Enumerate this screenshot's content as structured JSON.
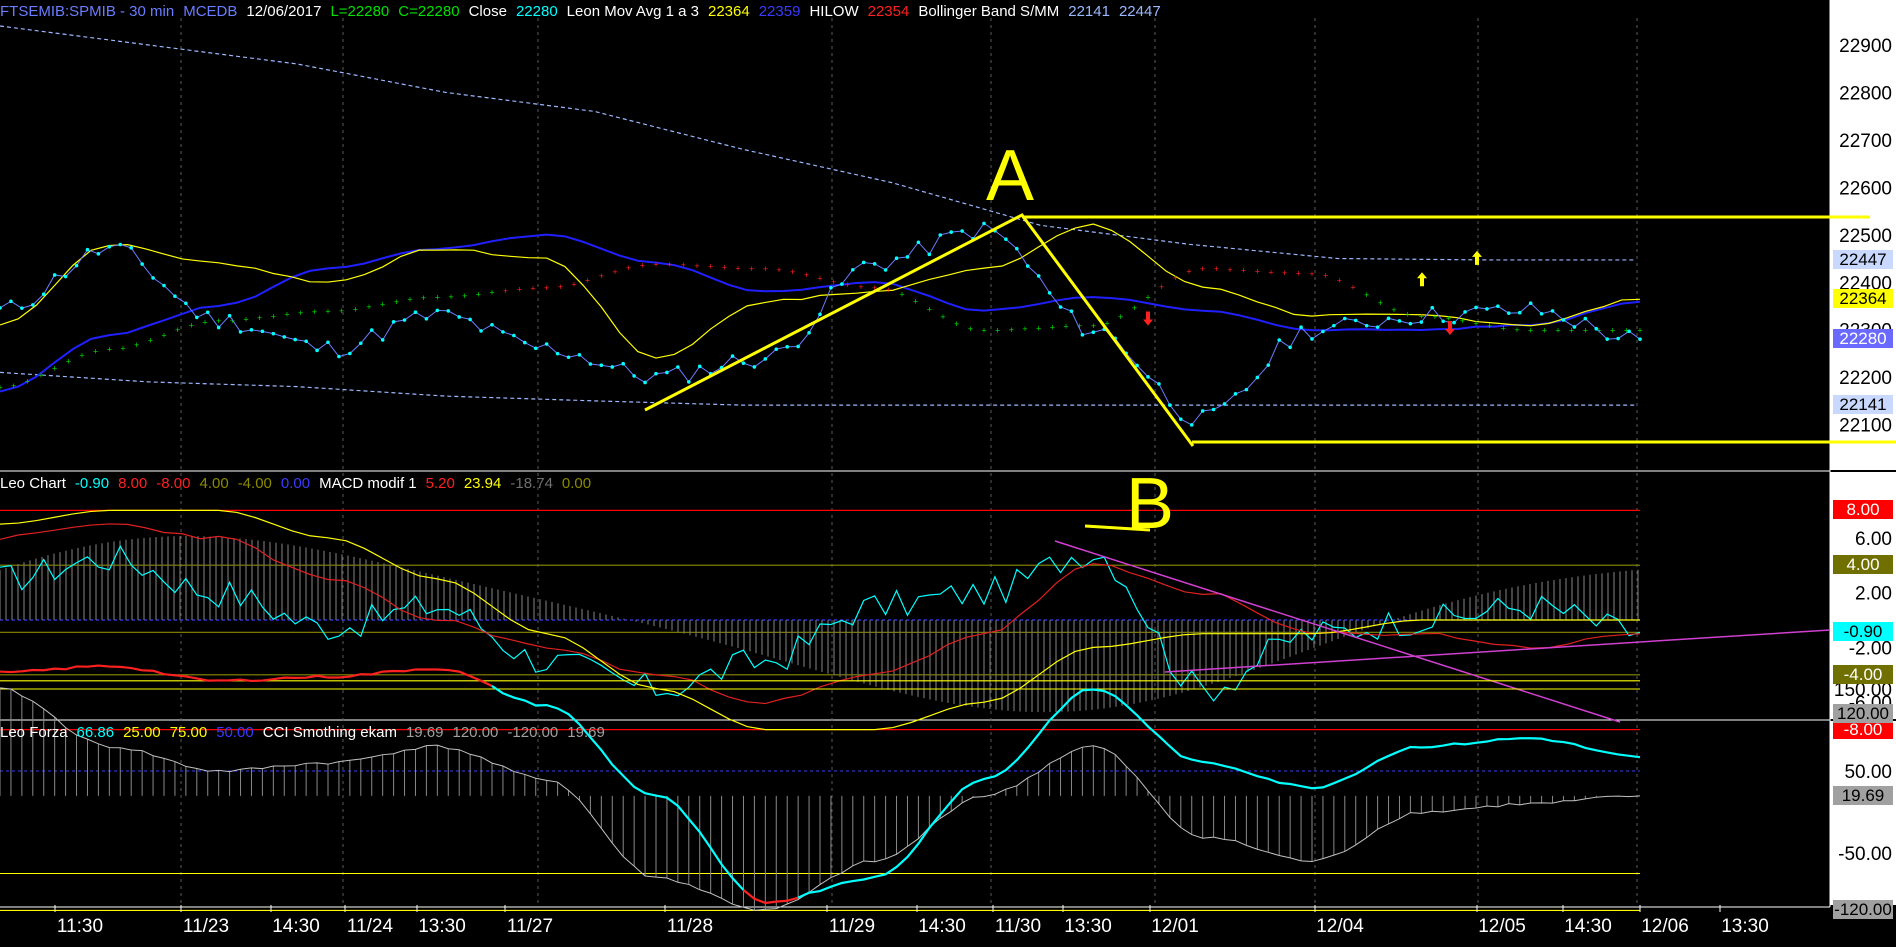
{
  "header_main": [
    {
      "text": "FTSEMIB:SPMIB - 30 min",
      "color": "#6a7dff"
    },
    {
      "text": "MCEDB",
      "color": "#6a7dff"
    },
    {
      "text": "12/06/2017",
      "color": "#ffffff"
    },
    {
      "text": "L=22280",
      "color": "#00e000"
    },
    {
      "text": "C=22280",
      "color": "#00e000"
    },
    {
      "text": "Close",
      "color": "#ffffff"
    },
    {
      "text": "22280",
      "color": "#00ffff"
    },
    {
      "text": "Leon Mov Avg 1 a 3",
      "color": "#ffffff"
    },
    {
      "text": "22364",
      "color": "#ffff00"
    },
    {
      "text": "22359",
      "color": "#3a3aff"
    },
    {
      "text": "HILOW",
      "color": "#ffffff"
    },
    {
      "text": "22354",
      "color": "#ff2020"
    },
    {
      "text": "Bollinger Band S/MM",
      "color": "#ffffff"
    },
    {
      "text": "22141",
      "color": "#9ab8ff"
    },
    {
      "text": "22447",
      "color": "#9ab8ff"
    }
  ],
  "header_mid": [
    {
      "text": "Leo Chart",
      "color": "#ffffff"
    },
    {
      "text": "-0.90",
      "color": "#00ffff"
    },
    {
      "text": "8.00",
      "color": "#ff2020"
    },
    {
      "text": "-8.00",
      "color": "#ff2020"
    },
    {
      "text": "4.00",
      "color": "#8a8a00"
    },
    {
      "text": "-4.00",
      "color": "#8a8a00"
    },
    {
      "text": "0.00",
      "color": "#3a3aff"
    },
    {
      "text": "MACD modif 1",
      "color": "#ffffff"
    },
    {
      "text": "5.20",
      "color": "#ff2020"
    },
    {
      "text": "23.94",
      "color": "#ffff00"
    },
    {
      "text": "-18.74",
      "color": "#707070"
    },
    {
      "text": "0.00",
      "color": "#8a8a00"
    }
  ],
  "header_low": [
    {
      "text": "Leo Forza",
      "color": "#ffffff"
    },
    {
      "text": "66.86",
      "color": "#00ffff"
    },
    {
      "text": "25.00",
      "color": "#ffff00"
    },
    {
      "text": "75.00",
      "color": "#ffff00"
    },
    {
      "text": "50.00",
      "color": "#3a3aff"
    },
    {
      "text": "CCI Smothing ekam",
      "color": "#ffffff"
    },
    {
      "text": "19.69",
      "color": "#a0a0a0"
    },
    {
      "text": "120.00",
      "color": "#a0a0a0"
    },
    {
      "text": "-120.00",
      "color": "#a0a0a0"
    },
    {
      "text": "19.69",
      "color": "#a0a0a0"
    }
  ],
  "axis_main": [
    "22900",
    "22800",
    "22700",
    "22600",
    "22500",
    "22400",
    "22300",
    "22200",
    "22100"
  ],
  "axis_mid": [
    "6.00",
    "2.00",
    "-2.00",
    "-6.00"
  ],
  "axis_low": [
    "150.00",
    "50.00",
    "-50.00"
  ],
  "tags_main": [
    {
      "text": "22447",
      "bg": "#c8d8ff",
      "fg": "#000000"
    },
    {
      "text": "22364",
      "bg": "#ffff00",
      "fg": "#000000"
    },
    {
      "text": "22280",
      "bg": "#6a6aff",
      "fg": "#ffffff"
    },
    {
      "text": "22141",
      "bg": "#c8d8ff",
      "fg": "#000000"
    }
  ],
  "tags_mid": [
    {
      "text": "8.00",
      "bg": "#ff0000",
      "fg": "#ffffff"
    },
    {
      "text": "4.00",
      "bg": "#707000",
      "fg": "#ffffff"
    },
    {
      "text": "-0.90",
      "bg": "#00ffff",
      "fg": "#000000"
    },
    {
      "text": "-4.00",
      "bg": "#707000",
      "fg": "#ffffff"
    },
    {
      "text": "-8.00",
      "bg": "#ff0000",
      "fg": "#ffffff"
    }
  ],
  "tags_low": [
    {
      "text": "120.00",
      "bg": "#a0a0a0",
      "fg": "#000000"
    },
    {
      "text": "19.69",
      "bg": "#a0a0a0",
      "fg": "#000000"
    },
    {
      "text": "-120.00",
      "bg": "#a0a0a0",
      "fg": "#000000"
    }
  ],
  "time_labels": [
    "11:30",
    "11/23",
    "14:30",
    "11/24",
    "13:30",
    "11/27",
    "11/28",
    "11/29",
    "14:30",
    "11/30",
    "13:30",
    "12/01",
    "12/04",
    "12/05",
    "14:30",
    "12/06",
    "13:30"
  ],
  "annotations": [
    "A",
    "B"
  ],
  "colors": {
    "background": "#000000",
    "close": "#00ffff",
    "hilow": "#2020ff",
    "leon_avg": "#ffff00",
    "bollinger": "#9ab8ff",
    "drawing": "#ffff00",
    "trend_magenta": "#d040d0"
  },
  "chart_data": [
    {
      "type": "line",
      "title": "FTSEMIB:SPMIB - 30 min",
      "ylim": [
        22080,
        22960
      ],
      "x": [
        "11/22 11:30",
        "11/23",
        "11/23 14:30",
        "11/24",
        "11/24 13:30",
        "11/27",
        "11/28",
        "11/29",
        "11/29 14:30",
        "11/30",
        "11/30 13:30",
        "12/01",
        "12/04",
        "12/05",
        "12/05 14:30",
        "12/06"
      ],
      "series": [
        {
          "name": "Close",
          "values": [
            22340,
            22470,
            22320,
            22260,
            22330,
            22260,
            22200,
            22240,
            22440,
            22510,
            22300,
            22110,
            22300,
            22330,
            22340,
            22280
          ]
        },
        {
          "name": "Leon Mov Avg 1 a 3",
          "values": [
            22310,
            22480,
            22440,
            22400,
            22470,
            22450,
            22240,
            22360,
            22380,
            22430,
            22520,
            22390,
            22330,
            22330,
            22310,
            22364
          ]
        },
        {
          "name": "HILOW",
          "values": [
            22170,
            22290,
            22350,
            22430,
            22470,
            22500,
            22440,
            22380,
            22400,
            22340,
            22370,
            22340,
            22300,
            22300,
            22310,
            22359
          ]
        },
        {
          "name": "Bollinger Band S/MM",
          "values": [
            22940,
            22900,
            22860,
            22800,
            22760,
            22680,
            22610,
            22520,
            22480,
            22450,
            22447,
            22447
          ]
        },
        {
          "name": "Bollinger Band S/MM",
          "values": [
            22210,
            22190,
            22180,
            22160,
            22150,
            22141,
            22141,
            22141,
            22141,
            22141,
            22141,
            22141
          ]
        }
      ]
    },
    {
      "type": "line",
      "title": "Leo Chart / MACD modif 1",
      "ylim": [
        -8,
        8
      ],
      "series": [
        {
          "name": "Leo Chart",
          "values": [
            3,
            4.5,
            2,
            -0.5,
            1,
            -3,
            -5,
            -3,
            1,
            2,
            5,
            -5,
            -1,
            0,
            1,
            -0.9
          ]
        },
        {
          "name": "MACD modif 1",
          "values": [
            4,
            5,
            3,
            0,
            -2,
            -4,
            -6,
            -5,
            -3,
            1,
            5,
            3,
            -1,
            -2,
            -1,
            5.2
          ]
        }
      ]
    },
    {
      "type": "line",
      "title": "Leo Forza / CCI Smothing ekam",
      "ylim": [
        -120,
        180
      ],
      "series": [
        {
          "name": "Leo Forza",
          "values": [
            170,
            178,
            160,
            165,
            175,
            130,
            20,
            -110,
            -80,
            40,
            150,
            60,
            30,
            80,
            90,
            66.86
          ]
        },
        {
          "name": "CCI Smothing ekam",
          "values": [
            150,
            80,
            50,
            60,
            80,
            40,
            -80,
            -120,
            -60,
            20,
            80,
            -30,
            -60,
            0,
            10,
            19.69
          ]
        }
      ]
    }
  ]
}
